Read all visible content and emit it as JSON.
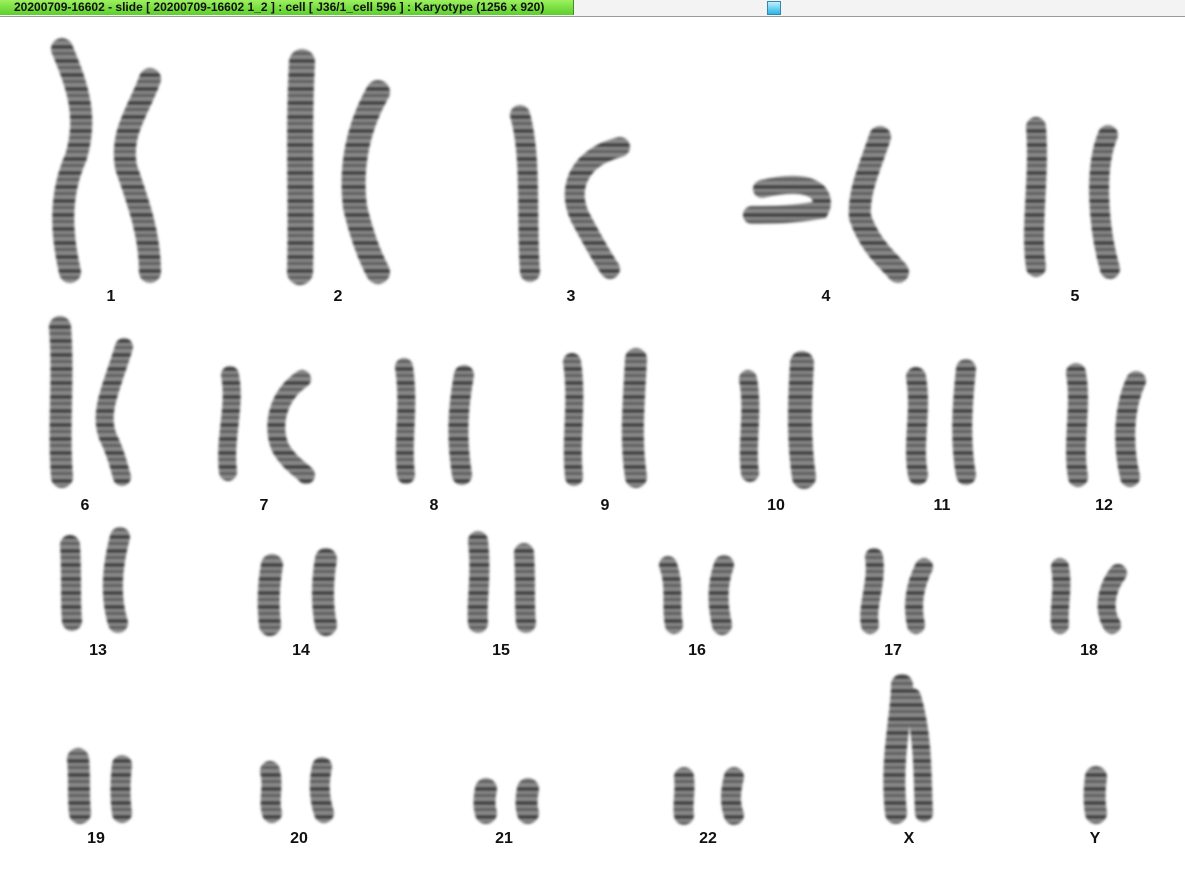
{
  "window": {
    "title": "20200709-16602 - slide [ 20200709-16602 1_2 ] : cell [ J36/1_cell 596 ] : Karyotype  (1256 x 920)"
  },
  "karyotype": {
    "labels": {
      "c1": "1",
      "c2": "2",
      "c3": "3",
      "c4": "4",
      "c5": "5",
      "c6": "6",
      "c7": "7",
      "c8": "8",
      "c9": "9",
      "c10": "10",
      "c11": "11",
      "c12": "12",
      "c13": "13",
      "c14": "14",
      "c15": "15",
      "c16": "16",
      "c17": "17",
      "c18": "18",
      "c19": "19",
      "c20": "20",
      "c21": "21",
      "c22": "22",
      "cX": "X",
      "cY": "Y"
    }
  }
}
